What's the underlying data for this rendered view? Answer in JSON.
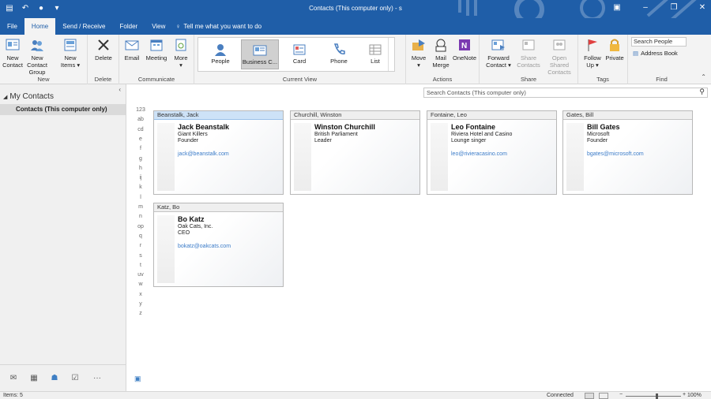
{
  "window": {
    "title": "Contacts (This computer only) - s",
    "controls": [
      "ribbon-display-icon",
      "minimize-icon",
      "restore-icon",
      "close-icon"
    ]
  },
  "tabs": [
    {
      "label": "File"
    },
    {
      "label": "Home",
      "active": true
    },
    {
      "label": "Send / Receive"
    },
    {
      "label": "Folder"
    },
    {
      "label": "View"
    }
  ],
  "tellme": {
    "label": "Tell me what you want to do"
  },
  "ribbon": {
    "new": {
      "label": "New",
      "new_contact": "New\nContact",
      "new_contact_group": "New Contact\nGroup",
      "new_items": "New\nItems ▾"
    },
    "delete": {
      "label": "Delete",
      "delete_btn": "Delete"
    },
    "communicate": {
      "label": "Communicate",
      "email": "Email",
      "meeting": "Meeting",
      "more": "More\n▾"
    },
    "current_view": {
      "label": "Current View",
      "views": [
        "People",
        "Business C...",
        "Card",
        "Phone",
        "List"
      ],
      "selected": "Business C..."
    },
    "actions": {
      "label": "Actions",
      "move": "Move\n▾",
      "mail_merge": "Mail\nMerge",
      "onenote": "OneNote"
    },
    "share": {
      "label": "Share",
      "forward_contact": "Forward\nContact ▾",
      "share_contacts": "Share\nContacts",
      "open_shared": "Open Shared\nContacts"
    },
    "tags": {
      "label": "Tags",
      "follow_up": "Follow\nUp ▾",
      "private": "Private"
    },
    "find": {
      "label": "Find",
      "search_people": "Search People",
      "address_book": "Address Book"
    }
  },
  "folder_pane": {
    "header": "My Contacts",
    "items": [
      {
        "label": "Contacts (This computer only)",
        "selected": true
      }
    ]
  },
  "search": {
    "placeholder": "Search Contacts (This computer only)"
  },
  "alphabet": [
    "123",
    "ab",
    "cd",
    "e",
    "f",
    "g",
    "h",
    "ij",
    "k",
    "l",
    "m",
    "n",
    "op",
    "q",
    "r",
    "s",
    "t",
    "uv",
    "w",
    "x",
    "y",
    "z"
  ],
  "contacts": [
    {
      "file_as": "Beanstalk, Jack",
      "name": "Jack Beanstalk",
      "company": "Giant Killers",
      "title": "Founder",
      "email": "jack@beanstalk.com",
      "selected": true
    },
    {
      "file_as": "Churchill, Winston",
      "name": "Winston Churchill",
      "company": "British Parliament",
      "title": "Leader",
      "email": ""
    },
    {
      "file_as": "Fontaine, Leo",
      "name": "Leo Fontaine",
      "company": "Riviera Hotel and Casino",
      "title": "Lounge singer",
      "email": "leo@rivieracasino.com"
    },
    {
      "file_as": "Gates, Bill",
      "name": "Bill Gates",
      "company": "Microsoft",
      "title": "Founder",
      "email": "bgates@microsoft.com"
    },
    {
      "file_as": "Katz, Bo",
      "name": "Bo Katz",
      "company": "Oak Cats, Inc.",
      "title": "CEO",
      "email": "bokatz@oakcats.com"
    }
  ],
  "navbar": [
    "mail-icon",
    "calendar-icon",
    "people-icon",
    "tasks-icon",
    "more-icon"
  ],
  "status": {
    "items": "Items: 5",
    "connection": "Connected",
    "zoom": "100%",
    "zoom_level": 1.0
  },
  "colors": {
    "accent": "#1f5ea8",
    "selected_header": "#cde2f7",
    "email_link": "#3a7bc8"
  }
}
